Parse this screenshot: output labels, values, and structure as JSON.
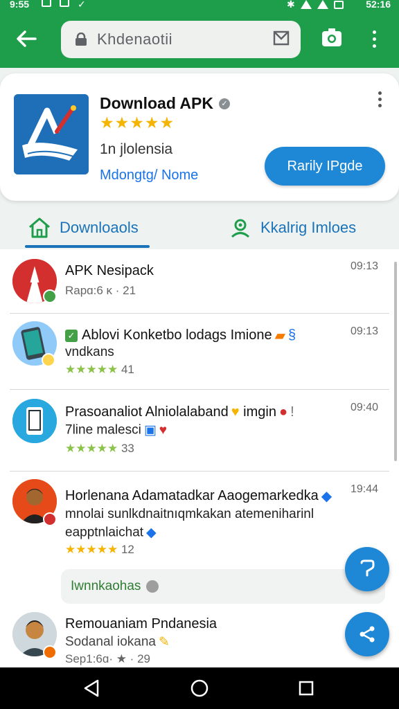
{
  "status_bar": {
    "time": "9:55",
    "battery_time": "52:16"
  },
  "toolbar": {
    "url": "Khdenaotii"
  },
  "app_card": {
    "title": "Download APK",
    "rating_stars": "★★★★★",
    "subtitle": "1n jlolensia",
    "link": "Mdongtg/ Nome",
    "button_label": "Rarily IPgde"
  },
  "tabs": [
    {
      "label": "Downloaols",
      "active": true
    },
    {
      "label": "Kkalrig Imloes",
      "active": false
    }
  ],
  "list": [
    {
      "title": "APK Nesipack",
      "line2": "",
      "meta": "Rapɑ:6 ĸ · 21",
      "stars": "",
      "time": "09:13"
    },
    {
      "title": "Ablovi Konketbo lodags Imione",
      "line2": "vndkans",
      "meta": "41",
      "stars": "★★★★★",
      "time": "09:13"
    },
    {
      "title": "Prasoanaliot Alniolalaband",
      "title_suffix": "imgin",
      "line2": "7line malesci",
      "meta": "33",
      "stars": "★★★★★",
      "time": "09:40"
    },
    {
      "title": "Horlenana Adamatadkar Aaogemarkedka",
      "line2": "mnolai sunlkdnaitnıqmkakan atemeniharinl",
      "line3": "eapptnlaichat",
      "meta": "12",
      "stars": "★★★★★",
      "time": "19:44"
    },
    {
      "title": "Remouaniam Pndanesia",
      "line2": "Sodanal iokana",
      "meta": "Sep1:6ɑ· ★ · 29",
      "stars": "",
      "time": ""
    }
  ],
  "chip": {
    "label": "Iwnnkaohas"
  },
  "colors": {
    "brand_green": "#1e9e4a",
    "accent_blue": "#1e88d6",
    "star_yellow": "#f4b400"
  }
}
